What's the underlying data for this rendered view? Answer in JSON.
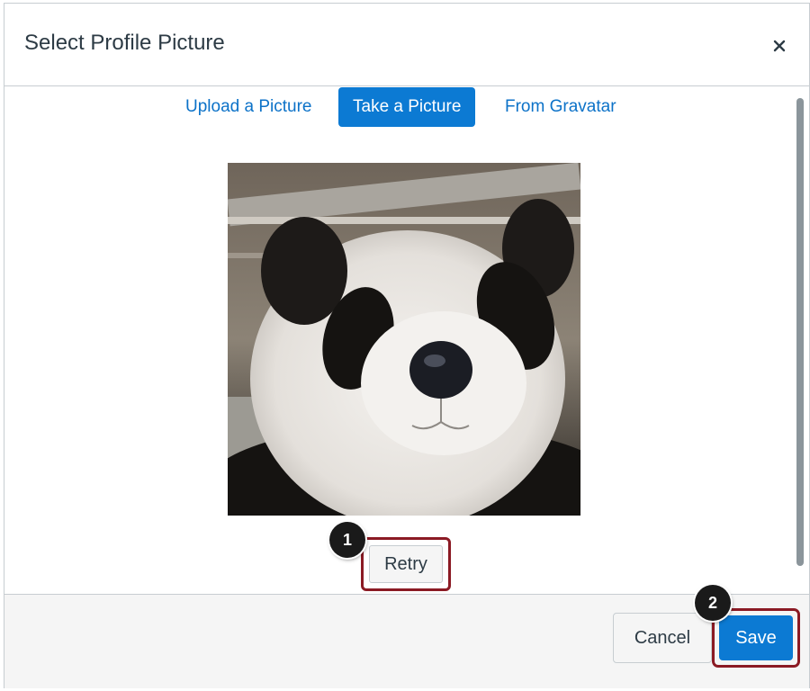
{
  "dialog": {
    "title": "Select Profile Picture",
    "close_icon": "close-icon"
  },
  "tabs": [
    {
      "label": "Upload a Picture",
      "active": false
    },
    {
      "label": "Take a Picture",
      "active": true
    },
    {
      "label": "From Gravatar",
      "active": false
    }
  ],
  "photo": {
    "subject": "captured-webcam-photo"
  },
  "retry_label": "Retry",
  "footer": {
    "cancel_label": "Cancel",
    "save_label": "Save"
  },
  "callouts": [
    "1",
    "2"
  ],
  "colors": {
    "accent": "#0c7ad3",
    "link": "#0c72c8",
    "highlight_border": "#8b1a24",
    "title_text": "#2d3b45"
  }
}
